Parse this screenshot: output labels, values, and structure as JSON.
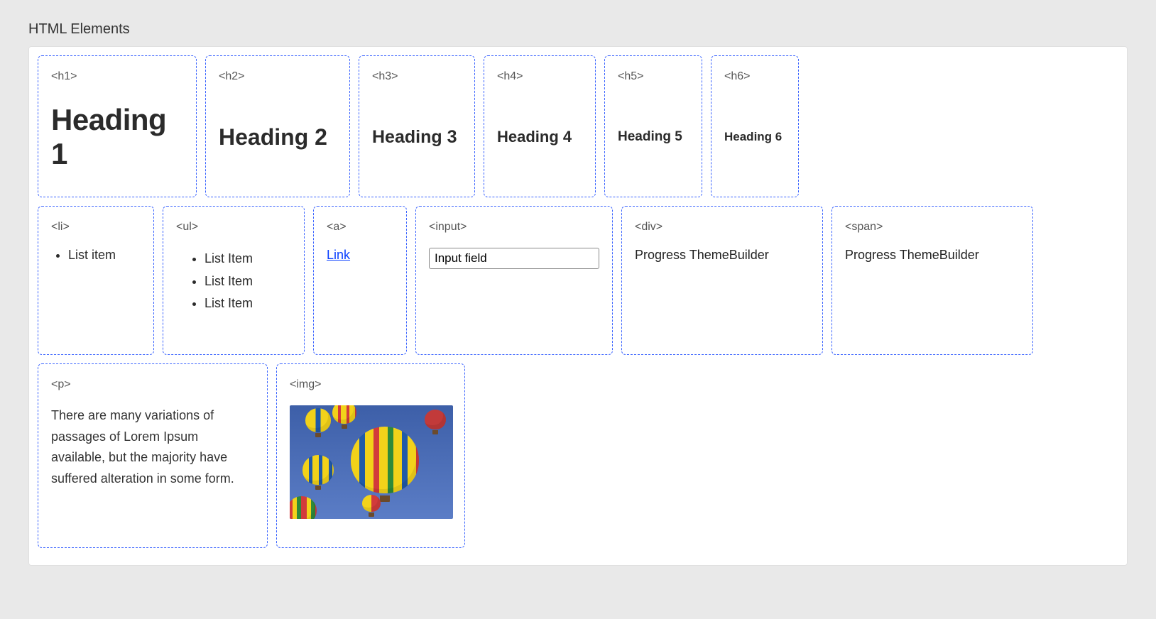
{
  "section_title": "HTML Elements",
  "headings": {
    "h1": {
      "tag": "<h1>",
      "text": "Heading 1"
    },
    "h2": {
      "tag": "<h2>",
      "text": "Heading 2"
    },
    "h3": {
      "tag": "<h3>",
      "text": "Heading 3"
    },
    "h4": {
      "tag": "<h4>",
      "text": "Heading 4"
    },
    "h5": {
      "tag": "<h5>",
      "text": "Heading 5"
    },
    "h6": {
      "tag": "<h6>",
      "text": "Heading 6"
    }
  },
  "li": {
    "tag": "<li>",
    "item": "List item"
  },
  "ul": {
    "tag": "<ul>",
    "items": [
      "List Item",
      "List Item",
      "List Item"
    ]
  },
  "a": {
    "tag": "<a>",
    "text": "Link"
  },
  "input": {
    "tag": "<input>",
    "value": "Input field"
  },
  "div": {
    "tag": "<div>",
    "text": "Progress ThemeBuilder"
  },
  "span": {
    "tag": "<span>",
    "text": "Progress ThemeBuilder"
  },
  "p": {
    "tag": "<p>",
    "text": "There are many variations of passages of Lorem Ipsum available, but the majority have suffered alteration in some form."
  },
  "img": {
    "tag": "<img>"
  }
}
